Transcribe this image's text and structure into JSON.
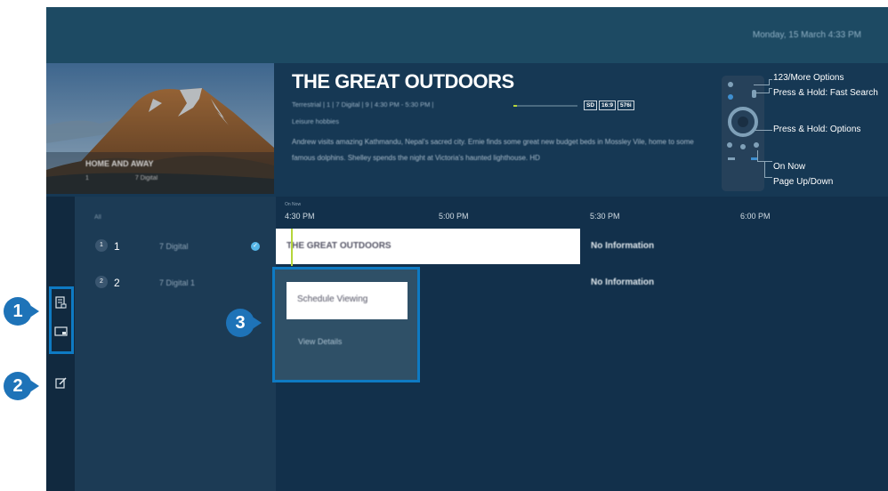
{
  "header": {
    "datetime": "Monday, 15 March  4:33 PM"
  },
  "banner": {
    "thumbnail_title": "HOME AND AWAY",
    "thumbnail_sub_left": "1",
    "thumbnail_sub_right": "7 Digital",
    "program_title": "THE GREAT OUTDOORS",
    "meta": "Terrestrial | 1 | 7 Digital | 9 | 4:30 PM - 5:30 PM |",
    "progress": 0.05,
    "badges": [
      "SD",
      "16:9",
      "576i"
    ],
    "genre": "Leisure hobbies",
    "description": "Andrew visits amazing Kathmandu, Nepal's sacred city. Ernie finds some great new budget beds in Mossley Vile, home to some famous dolphins. Shelley spends the night at Victoria's haunted lighthouse. HD"
  },
  "remote_hints": [
    "123/More Options",
    "Press & Hold: Fast Search",
    "Press & Hold: Options",
    "On Now",
    "Page Up/Down"
  ],
  "guide": {
    "channel_header": "All",
    "now_label": "On Now",
    "times": [
      "4:30 PM",
      "5:00 PM",
      "5:30 PM",
      "6:00 PM"
    ],
    "channels": [
      {
        "badge": "1",
        "number": "1",
        "name": "7 Digital",
        "checked": true
      },
      {
        "badge": "2",
        "number": "2",
        "name": "7 Digital 1",
        "checked": false
      }
    ],
    "programs": [
      {
        "title": "THE GREAT OUTDOORS",
        "next": "No Information"
      },
      {
        "title": "",
        "next": "No Information"
      }
    ]
  },
  "popup": {
    "schedule_label": "Schedule Viewing",
    "details_label": "View Details"
  },
  "callouts": [
    "1",
    "2",
    "3"
  ],
  "colors": {
    "accent": "#1e73b8",
    "highlight_border": "#0e7ac3",
    "now_line": "#b5d53b"
  }
}
